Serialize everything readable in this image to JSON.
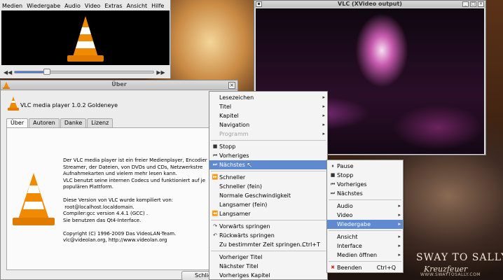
{
  "player": {
    "menubar": [
      "Medien",
      "Wiedergabe",
      "Audio",
      "Video",
      "Extras",
      "Ansicht",
      "Hilfe"
    ],
    "progress": 0.23
  },
  "about": {
    "title": "Über",
    "header": "VLC media player 1.0.2 Goldeneye",
    "tabs": [
      "Über",
      "Autoren",
      "Danke",
      "Lizenz"
    ],
    "active_tab": "Über",
    "body": "Der VLC media player ist ein freier Medienplayer, Encodier\nStreamer, der Dateien, von DVDs und CDs, Netzwerkstre\nAufnahmekarten und vielem mehr lesen kann.\nVLC benutzt seine internen Codecs und funktioniert auf je\npopulären Plattform.\n\nDiese Version von VLC wurde kompiliert von:\n root@localhost.localdomain.\nCompiler:gcc version 4.4.1 (GCC) .\nSie benutzen das Qt4-Interface.\n\nCopyright (C) 1996-2009 Das VideoLAN-Team.\nvlc@videolan.org, http://www.videolan.org",
    "close_button": "Schlie"
  },
  "video_window": {
    "title": "VLC (XVideo output)"
  },
  "context_menu": [
    {
      "label": "Lesezeichen",
      "submenu": true
    },
    {
      "label": "Titel",
      "submenu": true
    },
    {
      "label": "Kapitel",
      "submenu": true
    },
    {
      "label": "Navigation",
      "submenu": true
    },
    {
      "label": "Programm",
      "submenu": true,
      "disabled": true
    },
    {
      "separator": true
    },
    {
      "label": "Stopp",
      "icon": "■"
    },
    {
      "label": "Vorheriges",
      "icon": "⏮"
    },
    {
      "label": "Nächstes",
      "icon": "⏭",
      "highlight": true
    },
    {
      "separator": true
    },
    {
      "label": "Schneller",
      "icon": "⏩"
    },
    {
      "label": "Schneller (fein)"
    },
    {
      "label": "Normale Geschwindigkeit"
    },
    {
      "label": "Langsamer (fein)"
    },
    {
      "label": "Langsamer",
      "icon": "⏪"
    },
    {
      "separator": true
    },
    {
      "label": "Vorwärts springen",
      "icon": "↷"
    },
    {
      "label": "Rückwärts springen",
      "icon": "↶"
    },
    {
      "label": "Zu bestimmter Zeit springen...",
      "shortcut": "Ctrl+T"
    },
    {
      "separator": true
    },
    {
      "label": "Vorheriger Titel"
    },
    {
      "label": "Nächster Titel"
    },
    {
      "label": "Vorheriges Kapitel"
    }
  ],
  "submenu": [
    {
      "label": "Pause",
      "icon": "⏸"
    },
    {
      "label": "Stopp",
      "icon": "■"
    },
    {
      "label": "Vorheriges",
      "icon": "⏮"
    },
    {
      "label": "Nächstes",
      "icon": "⏭"
    },
    {
      "separator": true
    },
    {
      "label": "Audio",
      "submenu": true
    },
    {
      "label": "Video",
      "submenu": true
    },
    {
      "label": "Wiedergabe",
      "submenu": true,
      "highlight": true
    },
    {
      "separator": true
    },
    {
      "label": "Ansicht",
      "submenu": true
    },
    {
      "label": "Interface",
      "submenu": true
    },
    {
      "label": "Medien öffnen",
      "submenu": true
    },
    {
      "separator": true
    },
    {
      "label": "Beenden",
      "icon": "✖",
      "shortcut": "Ctrl+Q",
      "danger": true
    }
  ],
  "wallpaper": {
    "band": "SWAY TO SALLY",
    "album": "Kreuzfeuer",
    "url": "WWW.SWAYTOSALLY.COM"
  },
  "colors": {
    "highlight": "#5f89d0",
    "vlc_orange": "#f08a00"
  }
}
